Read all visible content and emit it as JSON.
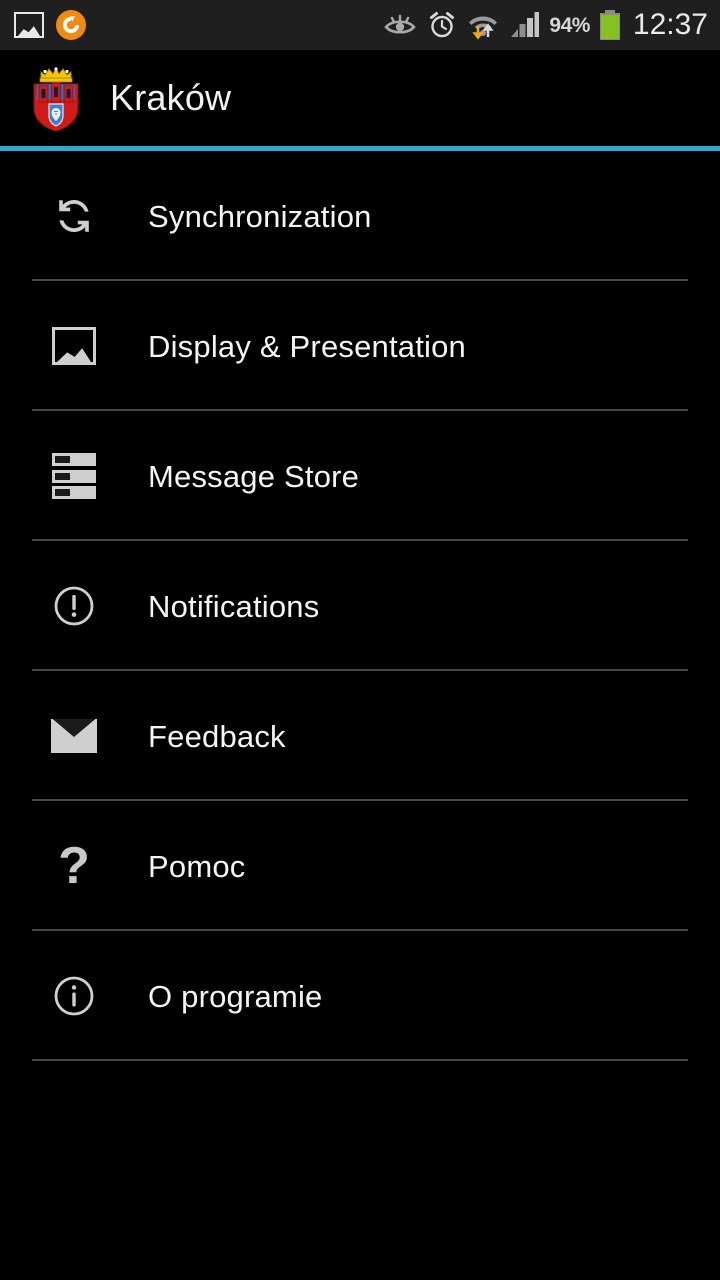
{
  "statusbar": {
    "left_icons": [
      {
        "name": "screenshot-icon",
        "label": "Screenshot captured"
      },
      {
        "name": "app-notification-icon",
        "label": "App notification"
      }
    ],
    "right_icons": [
      {
        "name": "smart-stay-eye-icon",
        "label": "Smart stay"
      },
      {
        "name": "alarm-clock-icon",
        "label": "Alarm set"
      },
      {
        "name": "wifi-icon",
        "label": "Wi-Fi connected"
      },
      {
        "name": "cellular-signal-icon",
        "label": "Cellular signal"
      }
    ],
    "battery_percent": "94%",
    "time": "12:37",
    "colors": {
      "background": "#1f1f1f",
      "battery_fill": "#85c220",
      "text": "#e9e9e9"
    }
  },
  "actionbar": {
    "title": "Kraków",
    "icon": "krakow-coat-of-arms",
    "accent_color": "#33a5d8",
    "background": "#000000"
  },
  "menu": {
    "items": [
      {
        "label": "Synchronization",
        "icon": "sync-icon"
      },
      {
        "label": "Display & Presentation",
        "icon": "image-icon"
      },
      {
        "label": "Message Store",
        "icon": "storage-icon"
      },
      {
        "label": "Notifications",
        "icon": "alert-circle-icon"
      },
      {
        "label": "Feedback",
        "icon": "envelope-icon"
      },
      {
        "label": "Pomoc",
        "icon": "question-mark-icon"
      },
      {
        "label": "O programie",
        "icon": "info-circle-icon"
      }
    ],
    "divider_color": "#474747",
    "text_color": "#f5f5f5",
    "icon_color": "#cfcfcf"
  }
}
